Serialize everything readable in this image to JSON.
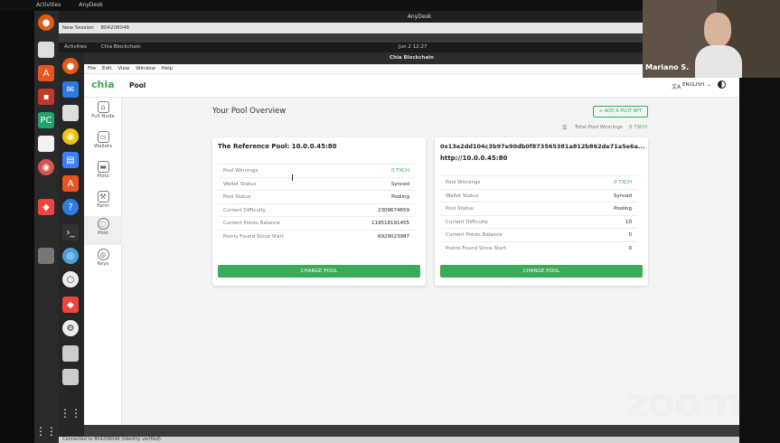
{
  "host_bar": {
    "activities": "Activities",
    "app": "AnyDesk"
  },
  "anydesk": {
    "title": "AnyDesk",
    "tab_new": "New Session",
    "tab_id": "804208046"
  },
  "remote_bar": {
    "activities": "Activities",
    "app": "Chia Blockchain",
    "clock": "Jun 2  12:27"
  },
  "window_title": "Chia Blockchain",
  "menu": [
    "File",
    "Edit",
    "View",
    "Window",
    "Help"
  ],
  "header": {
    "logo": "chia",
    "page": "Pool",
    "language": "ENGLISH"
  },
  "sidebar": [
    {
      "label": "Full Node",
      "icon": "home-icon"
    },
    {
      "label": "Wallets",
      "icon": "wallet-icon"
    },
    {
      "label": "Plots",
      "icon": "drive-icon"
    },
    {
      "label": "Farm",
      "icon": "tractor-icon"
    },
    {
      "label": "Pool",
      "icon": "pool-icon"
    },
    {
      "label": "Keys",
      "icon": "fingerprint-icon"
    }
  ],
  "overview": {
    "title": "Your Pool Overview",
    "add_button": "+ ADD A PLOT NFT",
    "total_label": "Total Pool Winnings",
    "total_value": "0 TXCH"
  },
  "cards": [
    {
      "title": "The Reference Pool: 10.0.0.45:80",
      "subtitle": "",
      "rows": [
        {
          "k": "Pool Winnings",
          "v": "0 TXCH"
        },
        {
          "k": "Wallet Status",
          "v": "Synced"
        },
        {
          "k": "Pool Status",
          "v": "Pooling"
        },
        {
          "k": "Current Difficulty",
          "v": "2309674659"
        },
        {
          "k": "Current Points Balance",
          "v": "119518191455"
        },
        {
          "k": "Points Found Since Start",
          "v": "6929023987"
        }
      ],
      "button": "CHANGE POOL"
    },
    {
      "title": "0x13e2dd104c3b97e90db0f873565381a812b862de71a5e6a...",
      "subtitle": "http://10.0.0.45:80",
      "rows": [
        {
          "k": "Pool Winnings",
          "v": "0 TXCH"
        },
        {
          "k": "Wallet Status",
          "v": "Synced"
        },
        {
          "k": "Pool Status",
          "v": "Pooling"
        },
        {
          "k": "Current Difficulty",
          "v": "10"
        },
        {
          "k": "Current Points Balance",
          "v": "0"
        },
        {
          "k": "Points Found Since Start",
          "v": "0"
        }
      ],
      "button": "CHANGE POOL"
    }
  ],
  "status_bar": "Connected to 804208046 (Identity verified).",
  "video": {
    "name": "Mariano S."
  },
  "zoom": "zoom",
  "colors": {
    "accent": "#3aac59",
    "chia_green": "#3aac59"
  }
}
